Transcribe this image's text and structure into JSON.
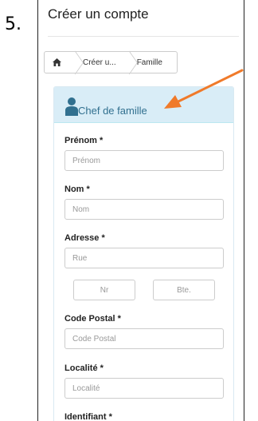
{
  "step": "5.",
  "page": {
    "title": "Créer un compte"
  },
  "breadcrumb": {
    "items": [
      "Créer u...",
      "Famille"
    ]
  },
  "panel": {
    "title": "Chef de famille"
  },
  "form": {
    "prenom": {
      "label": "Prénom *",
      "placeholder": "Prénom"
    },
    "nom": {
      "label": "Nom *",
      "placeholder": "Nom"
    },
    "adresse": {
      "label": "Adresse *",
      "rue": "Rue",
      "nr": "Nr",
      "bte": "Bte."
    },
    "code_postal": {
      "label": "Code Postal *",
      "placeholder": "Code Postal"
    },
    "localite": {
      "label": "Localité *",
      "placeholder": "Localité"
    },
    "identifiant": {
      "label": "Identifiant *"
    }
  },
  "colors": {
    "arrow": "#f07a2a",
    "panel_heading": "#d9edf7",
    "panel_title": "#31708f"
  }
}
